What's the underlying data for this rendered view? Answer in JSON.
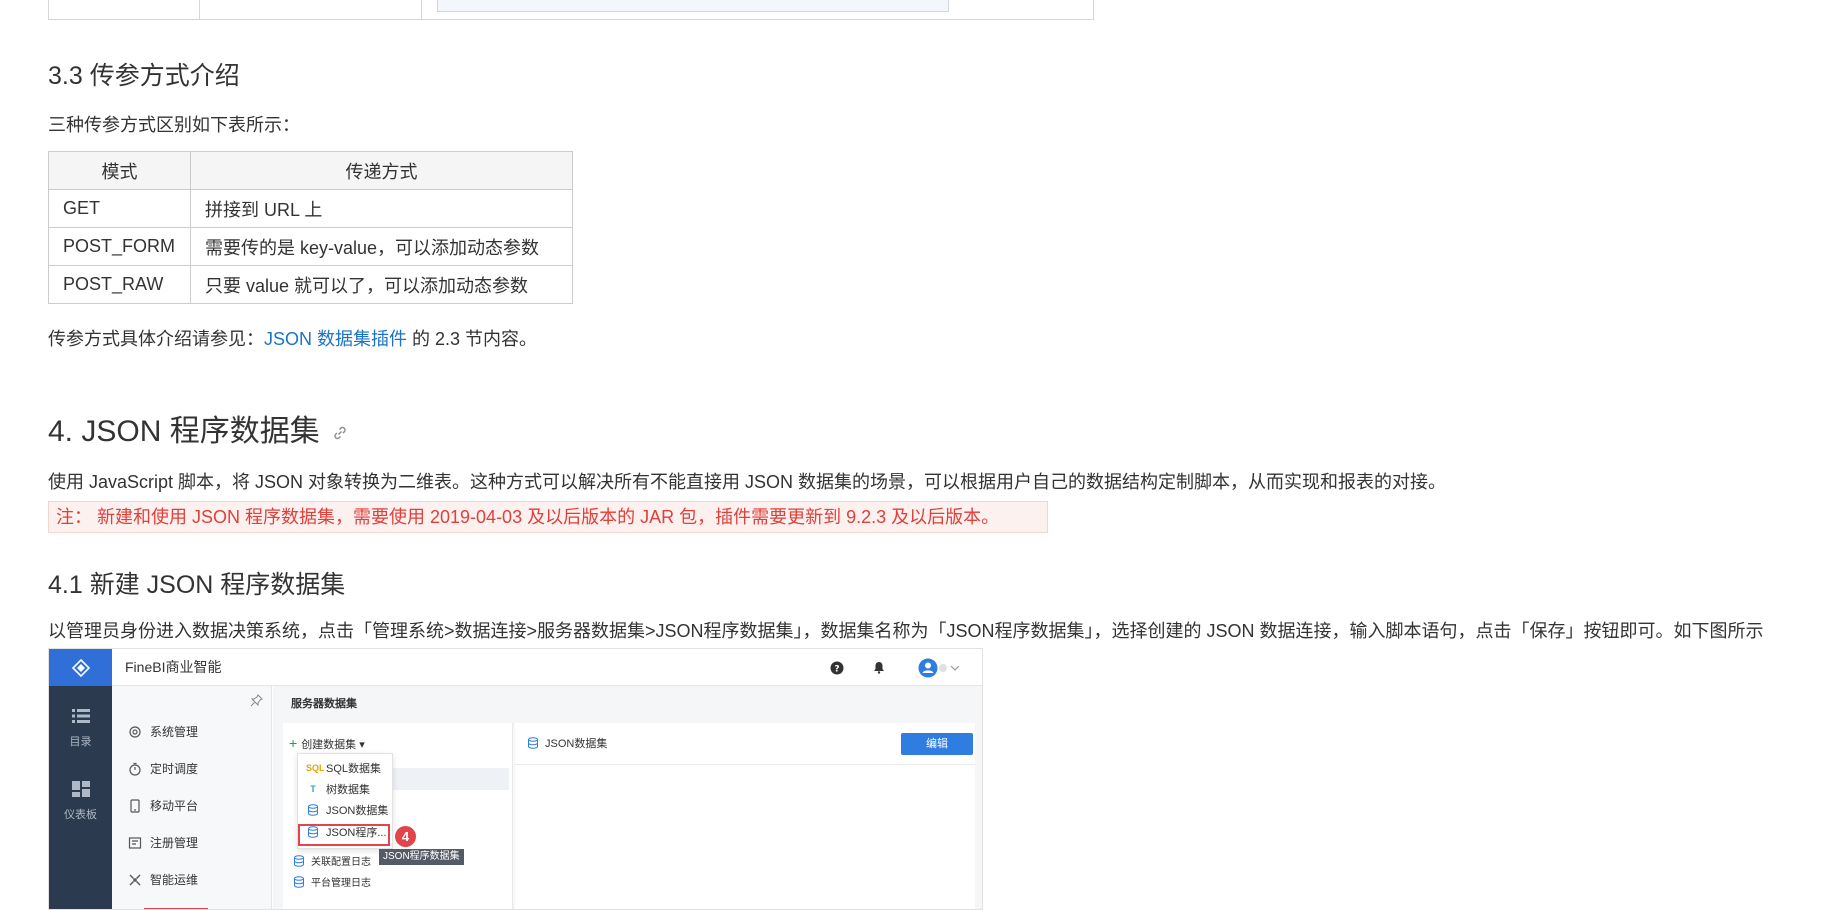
{
  "section_3_3": {
    "title": "3.3 传参方式介绍",
    "intro": "三种传参方式区别如下表所示：",
    "table": {
      "headers": [
        "模式",
        "传递方式"
      ],
      "rows": [
        [
          "GET",
          "拼接到 URL 上"
        ],
        [
          "POST_FORM",
          "需要传的是 key-value，可以添加动态参数"
        ],
        [
          "POST_RAW",
          "只要 value 就可以了，可以添加动态参数"
        ]
      ]
    },
    "ref_prefix": "传参方式具体介绍请参见：",
    "ref_link": "JSON 数据集插件",
    "ref_suffix": " 的 2.3 节内容。"
  },
  "section_4": {
    "title": "4. JSON 程序数据集",
    "anchor_icon": "link-icon",
    "desc": "使用 JavaScript 脚本，将 JSON 对象转换为二维表。这种方式可以解决所有不能直接用 JSON 数据集的场景，可以根据用户自己的数据结构定制脚本，从而实现和报表的对接。",
    "note": "注： 新建和使用 JSON 程序数据集，需要使用 2019-04-03 及以后版本的 JAR 包，插件需要更新到 9.2.3 及以后版本。"
  },
  "section_4_1": {
    "title": "4.1 新建 JSON 程序数据集",
    "desc": "以管理员身份进入数据决策系统，点击「管理系统>数据连接>服务器数据集>JSON程序数据集」，数据集名称为「JSON程序数据集」，选择创建的 JSON 数据连接，输入脚本语句，点击「保存」按钮即可。如下图所示"
  },
  "app_screenshot": {
    "brand": "FineBI商业智能",
    "left_nav": [
      "目录",
      "仪表板"
    ],
    "menu": [
      "系统管理",
      "定时调度",
      "移动平台",
      "注册管理",
      "智能运维"
    ],
    "content_title": "服务器数据集",
    "create_button": "创建数据集",
    "dropdown": [
      "SQL数据集",
      "树数据集",
      "JSON数据集",
      "JSON程序..."
    ],
    "dropdown_icons": [
      "SQL",
      "T",
      "",
      ""
    ],
    "step_badge": "4",
    "tooltip": "JSON程序数据集",
    "list": [
      "关联配置日志",
      "平台管理日志"
    ],
    "right_title": "JSON数据集",
    "edit_button": "编辑",
    "colors": {
      "accent": "#2f6fd7",
      "nav_bg": "#2b3a4e",
      "highlight": "#e3434a",
      "link": "#1a73c8"
    }
  }
}
